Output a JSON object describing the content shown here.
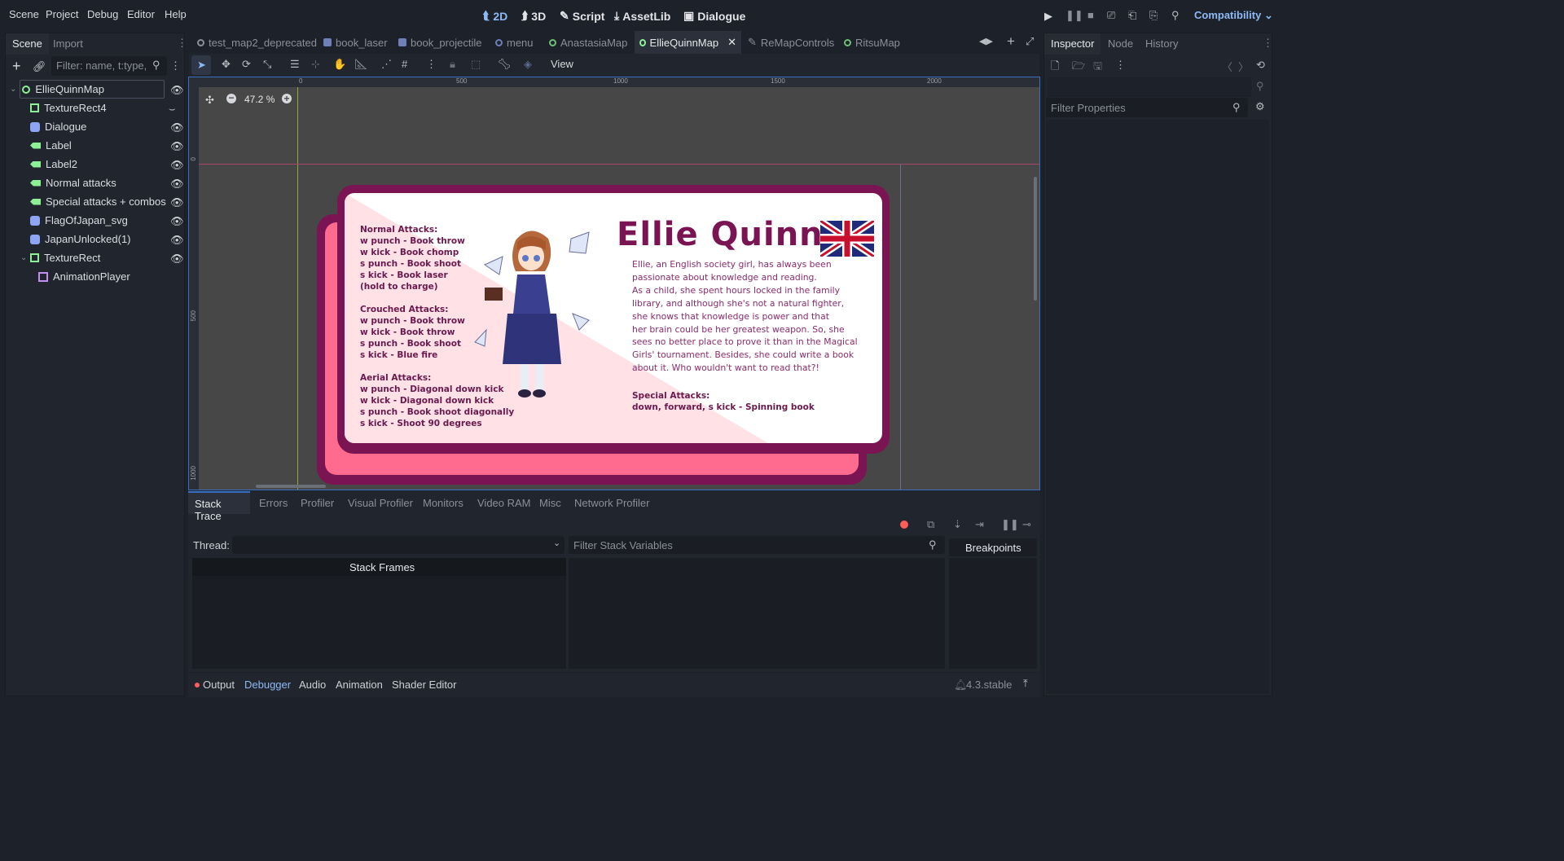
{
  "menu": [
    "Scene",
    "Project",
    "Debug",
    "Editor",
    "Help"
  ],
  "workspaces": [
    {
      "label": "2D",
      "icon": "2d-icon",
      "active": true
    },
    {
      "label": "3D",
      "icon": "3d-icon",
      "active": false
    },
    {
      "label": "Script",
      "icon": "script-icon",
      "active": false
    },
    {
      "label": "AssetLib",
      "icon": "assetlib-icon",
      "active": false
    },
    {
      "label": "Dialogue",
      "icon": "dialogue-icon",
      "active": false
    }
  ],
  "renderer": "Compatibility",
  "scene_dock": {
    "tabs": [
      "Scene",
      "Import"
    ],
    "filter_placeholder": "Filter: name, t:type,",
    "nodes": [
      {
        "label": "EllieQuinnMap",
        "icon": "control-node-icon"
      },
      {
        "label": "TextureRect4",
        "icon": "texture-rect-icon"
      },
      {
        "label": "Dialogue",
        "icon": "dialogue-node-icon"
      },
      {
        "label": "Label",
        "icon": "label-node-icon"
      },
      {
        "label": "Label2",
        "icon": "label-node-icon"
      },
      {
        "label": "Normal attacks",
        "icon": "label-node-icon"
      },
      {
        "label": "Special attacks + combos",
        "icon": "label-node-icon"
      },
      {
        "label": "FlagOfJapan_svg",
        "icon": "dialogue-node-icon"
      },
      {
        "label": "JapanUnlocked(1)",
        "icon": "dialogue-node-icon"
      },
      {
        "label": "TextureRect",
        "icon": "texture-rect-icon"
      },
      {
        "label": "AnimationPlayer",
        "icon": "animation-player-icon"
      }
    ]
  },
  "scene_tabs": [
    {
      "label": "test_map2_deprecated",
      "icon": "control-node-icon"
    },
    {
      "label": "book_laser",
      "icon": "dialogue-node-icon"
    },
    {
      "label": "book_projectile",
      "icon": "dialogue-node-icon"
    },
    {
      "label": "menu",
      "icon": "control-node-icon"
    },
    {
      "label": "AnastasiaMap",
      "icon": "control-node-icon"
    },
    {
      "label": "EllieQuinnMap",
      "icon": "control-node-icon"
    },
    {
      "label": "ReMapControls",
      "icon": "edit-icon"
    },
    {
      "label": "RitsuMap",
      "icon": "control-node-icon"
    }
  ],
  "toolbar": {
    "view_label": "View"
  },
  "viewport": {
    "zoom": "47.2 %",
    "ruler_h": [
      "0",
      "500",
      "1000",
      "1500",
      "2000"
    ],
    "ruler_v": [
      "0",
      "500",
      "1000"
    ]
  },
  "card": {
    "name": "Ellie Quinn",
    "normal_title": "Normal Attacks:",
    "normal": [
      "w punch - Book throw",
      "w kick - Book chomp",
      "s punch - Book shoot",
      "s kick - Book laser",
      "(hold to charge)"
    ],
    "crouched_title": "Crouched Attacks:",
    "crouched": [
      "w punch - Book throw",
      "w kick - Book throw",
      "s punch - Book shoot",
      "s kick - Blue fire"
    ],
    "aerial_title": "Aerial Attacks:",
    "aerial": [
      "w punch - Diagonal down kick",
      "w kick - Diagonal down kick",
      "s punch - Book shoot diagonally",
      "s kick - Shoot 90 degrees"
    ],
    "bio": [
      "Ellie, an English society girl, has always been",
      "passionate about knowledge and reading.",
      "As a child, she spent hours locked in the family",
      "library, and although she's not a natural fighter,",
      "she knows that knowledge is power and that",
      "her brain could be her greatest weapon. So, she",
      "sees no better place to prove it than in the Magical",
      "Girls' tournament. Besides, she could write a book",
      "about it. Who wouldn't want to read that?!"
    ],
    "special_title": "Special Attacks:",
    "special": "down, forward, s kick - Spinning book"
  },
  "debugger": {
    "tabs": [
      "Stack Trace",
      "Errors",
      "Profiler",
      "Visual Profiler",
      "Monitors",
      "Video RAM",
      "Misc",
      "Network Profiler"
    ],
    "thread_label": "Thread:",
    "filter_placeholder": "Filter Stack Variables",
    "stack_frames": "Stack Frames",
    "breakpoints": "Breakpoints"
  },
  "bottom_tabs": [
    "Output",
    "Debugger",
    "Audio",
    "Animation",
    "Shader Editor"
  ],
  "version": "4.3.stable",
  "inspector": {
    "tabs": [
      "Inspector",
      "Node",
      "History"
    ],
    "filter_placeholder": "Filter Properties"
  },
  "colors": {
    "accent": "#8fb9f5",
    "card_maroon": "#6b1a4e",
    "card_pink": "#ff6b8f",
    "bg": "#1d2129"
  }
}
